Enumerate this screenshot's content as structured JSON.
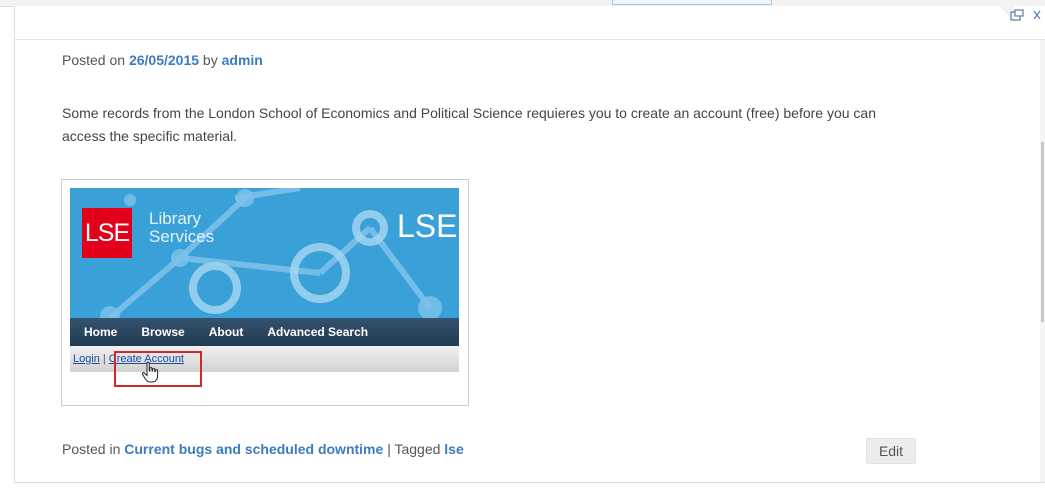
{
  "post": {
    "posted_on_prefix": "Posted on",
    "date": "26/05/2015",
    "by_word": "by",
    "author": "admin",
    "body": "Some records from the London School of Economics and Political Science requieres you to create an account (free) before you can access the specific material."
  },
  "figure": {
    "logo_text": "LSE",
    "library_line1": "Library",
    "library_line2": "Services",
    "right_title": "LSE",
    "nav": [
      "Home",
      "Browse",
      "About",
      "Advanced Search"
    ],
    "login_label": "Login",
    "separator": "|",
    "create_account_label": "Create Account"
  },
  "footer": {
    "posted_in_prefix": "Posted in",
    "category": "Current bugs and scheduled downtime",
    "tagged_sep": "| Tagged",
    "tag": "lse",
    "edit_label": "Edit"
  },
  "icons": {
    "popout": "popout-icon",
    "close": "close-icon",
    "cursor": "hand-cursor-icon"
  },
  "colors": {
    "link": "#3b7bbf",
    "logo_red": "#e2001a",
    "banner_blue": "#3aa0d8",
    "nav_dark": "#203b52",
    "highlight_red": "#d32626"
  }
}
